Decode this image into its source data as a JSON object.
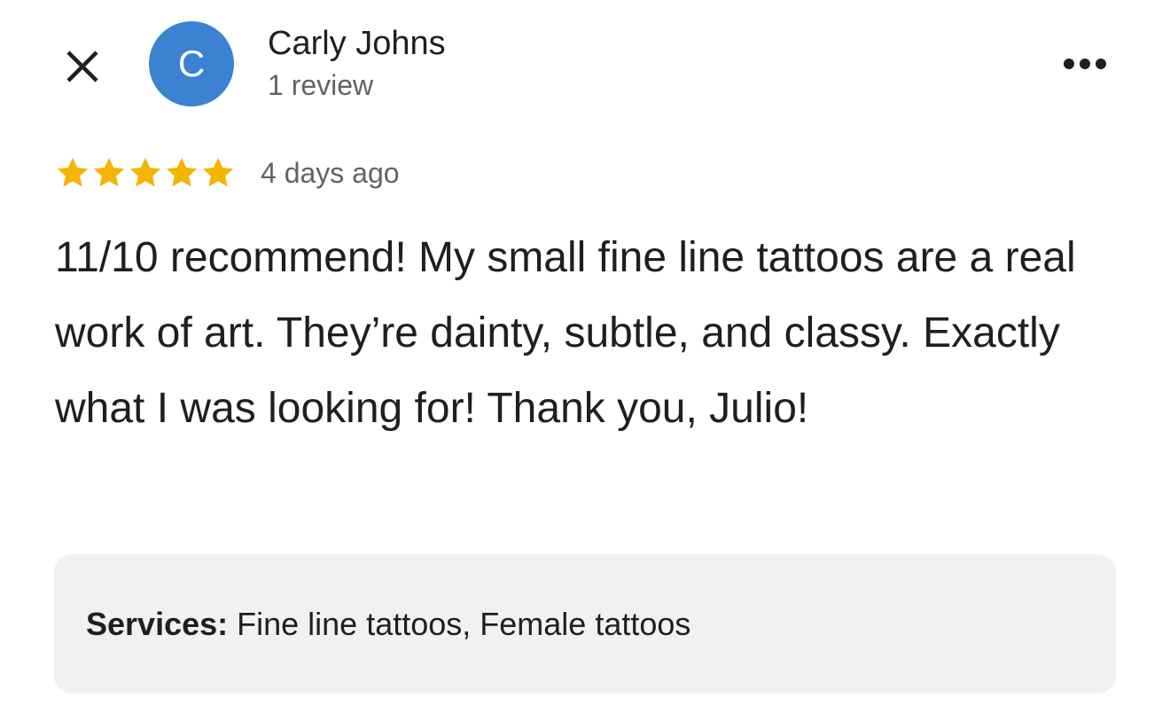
{
  "header": {
    "close_icon": "close-icon",
    "avatar_letter": "C",
    "avatar_color": "#3b82d0",
    "author_name": "Carly Johns",
    "author_review_count": "1 review",
    "more_icon": "more-horizontal-icon"
  },
  "review": {
    "rating": 5,
    "rating_max": 5,
    "star_color": "#f4b400",
    "date": "4 days ago",
    "text": "11/10 recommend! My small fine line tattoos are a real work of art. They’re dainty, subtle, and classy. Exactly what I was looking for! Thank you, Julio!"
  },
  "services": {
    "label": "Services:",
    "value": " Fine line tattoos, Female tattoos"
  }
}
